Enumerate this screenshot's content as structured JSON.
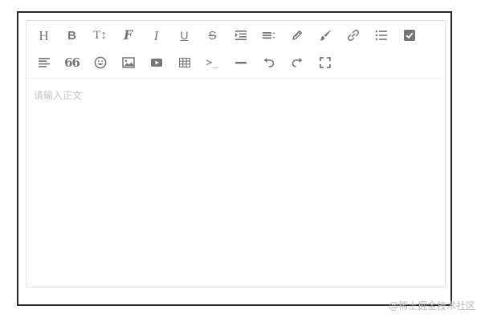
{
  "editor": {
    "placeholder": "请输入正文",
    "toolbar_row1": [
      {
        "icon": "heading-icon",
        "glyph": "H"
      },
      {
        "icon": "bold-icon",
        "glyph": "B"
      },
      {
        "icon": "font-size-icon",
        "glyph": "T↕"
      },
      {
        "icon": "font-family-icon",
        "glyph": "F"
      },
      {
        "icon": "italic-icon",
        "glyph": "I"
      },
      {
        "icon": "underline-icon",
        "glyph": "U"
      },
      {
        "icon": "strikethrough-icon",
        "glyph": "S"
      },
      {
        "icon": "indent-icon"
      },
      {
        "icon": "line-height-icon"
      },
      {
        "icon": "pencil-icon"
      },
      {
        "icon": "brush-icon"
      },
      {
        "icon": "link-icon"
      },
      {
        "icon": "list-icon"
      },
      {
        "icon": "checkbox-icon"
      }
    ],
    "toolbar_row2": [
      {
        "icon": "align-left-icon"
      },
      {
        "icon": "quote-icon",
        "glyph": "66"
      },
      {
        "icon": "emoji-icon"
      },
      {
        "icon": "image-icon"
      },
      {
        "icon": "video-icon"
      },
      {
        "icon": "table-icon"
      },
      {
        "icon": "code-icon",
        "glyph": ">_"
      },
      {
        "icon": "horizontal-rule-icon"
      },
      {
        "icon": "undo-icon"
      },
      {
        "icon": "redo-icon"
      },
      {
        "icon": "fullscreen-icon"
      }
    ]
  },
  "watermark": "@稀土掘金技术社区",
  "colors": {
    "icon": "#757575",
    "placeholder": "#c4c4c4",
    "border": "#dfe3e6"
  }
}
